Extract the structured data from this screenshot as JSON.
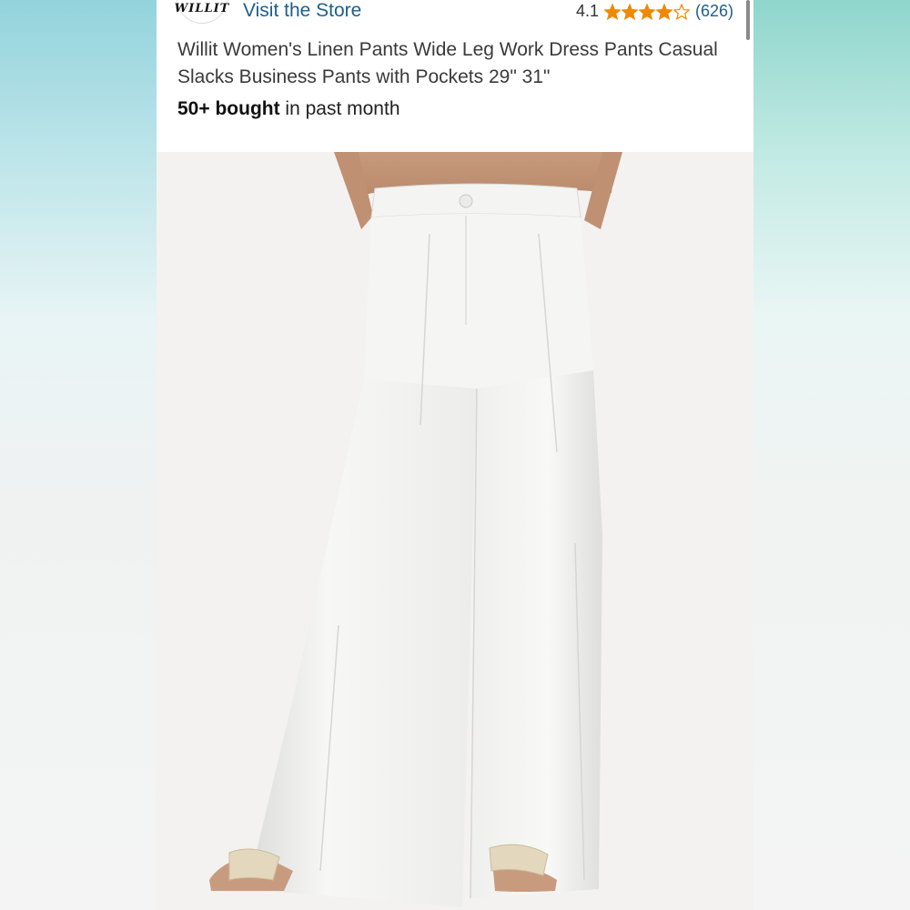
{
  "store": {
    "logo_text": "WILLIT",
    "link_label": "Visit the Store"
  },
  "rating": {
    "value": "4.1",
    "stars_filled": 4,
    "stars_total": 5,
    "review_count": "(626)",
    "star_color": "#f08804",
    "link_color": "#1d5f8a"
  },
  "product": {
    "title": "Willit Women's Linen Pants Wide Leg Work Dress Pants Casual Slacks Business Pants with Pockets 29\" 31\"",
    "bought_bold": "50+ bought",
    "bought_rest": " in past month",
    "image_alt": "Model wearing white wide leg linen pants with sandals"
  },
  "icons": {
    "star_filled": "star-filled-icon",
    "star_empty": "star-empty-icon"
  }
}
